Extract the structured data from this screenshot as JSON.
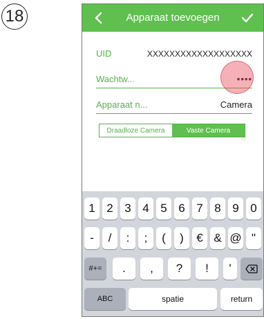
{
  "step": {
    "number": "18"
  },
  "navbar": {
    "back_icon": "chevron-left-icon",
    "title": "Apparaat toevoegen",
    "confirm_icon": "checkmark-icon",
    "color": "#5fbf4f"
  },
  "form": {
    "uid": {
      "label": "UID",
      "value": "XXXXXXXXXXXXXXXXXXX"
    },
    "password": {
      "label": "Wachtw...",
      "value": "••••"
    },
    "device_name": {
      "label": "Apparaat n...",
      "value": "Camera"
    },
    "camera_type": {
      "options": [
        "Draadloze Camera",
        "Vaste Camera"
      ],
      "selected": "Draadloze Camera"
    }
  },
  "keyboard": {
    "row1": [
      "1",
      "2",
      "3",
      "4",
      "5",
      "6",
      "7",
      "8",
      "9",
      "0"
    ],
    "row2": [
      "-",
      "/",
      ":",
      ";",
      "(",
      ")",
      "€",
      "&",
      "@",
      "\""
    ],
    "row3": {
      "mode": "#+=",
      "keys": [
        ".",
        ",",
        "?",
        "!",
        "'"
      ],
      "backspace_icon": "backspace-icon"
    },
    "row4": {
      "abc": "ABC",
      "space": "spatie",
      "return": "return"
    }
  },
  "accent_color": "#56b04a",
  "tap_indicator_color": "#eb505f"
}
